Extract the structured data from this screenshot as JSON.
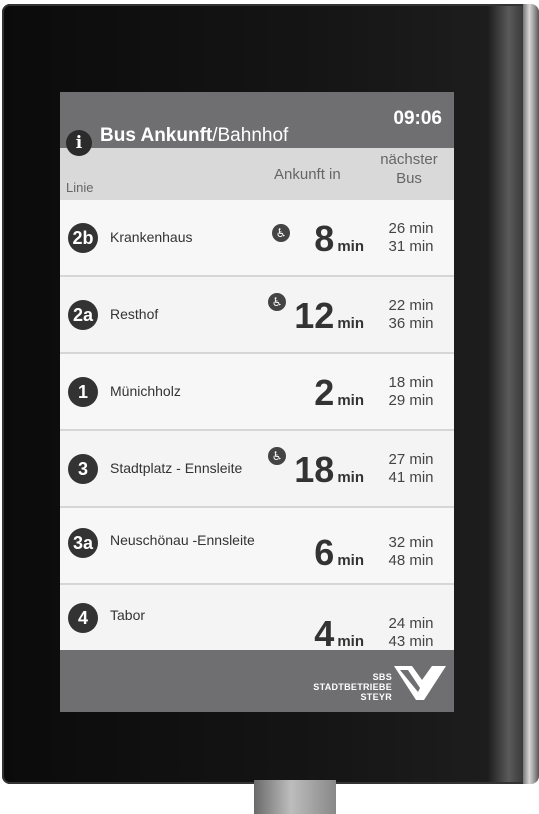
{
  "header": {
    "title_bold": "Bus Ankunft",
    "title_rest": "/Bahnhof",
    "time": "09:06"
  },
  "columns": {
    "line": "Linie",
    "arrival": "Ankunft in",
    "next": [
      "nächster",
      "Bus"
    ]
  },
  "rows": [
    {
      "line": "2b",
      "destination": "Krankenhaus",
      "accessible": true,
      "minutes": "8",
      "unit": "min",
      "next": [
        "26 min",
        "31 min"
      ]
    },
    {
      "line": "2a",
      "destination": "Resthof",
      "accessible": true,
      "minutes": "12",
      "unit": "min",
      "next": [
        "22 min",
        "36 min"
      ]
    },
    {
      "line": "1",
      "destination": "Münichholz",
      "accessible": false,
      "minutes": "2",
      "unit": "min",
      "next": [
        "18 min",
        "29 min"
      ]
    },
    {
      "line": "3",
      "destination": "Stadtplatz - Ennsleite",
      "accessible": true,
      "minutes": "18",
      "unit": "min",
      "next": [
        "27 min",
        "41 min"
      ]
    },
    {
      "line": "3a",
      "destination": "Neuschönau -Ennsleite",
      "accessible": false,
      "minutes": "6",
      "unit": "min",
      "next": [
        "32 min",
        "48 min"
      ]
    },
    {
      "line": "4",
      "destination": "Tabor",
      "accessible": false,
      "minutes": "4",
      "unit": "min",
      "next": [
        "24 min",
        "43 min"
      ]
    }
  ],
  "footer": {
    "logo_lines": [
      "SBS",
      "STADTBETRIEBE",
      "STEYR"
    ]
  },
  "icons": {
    "info": "info-icon",
    "wheelchair": "wheelchair-icon"
  },
  "colors": {
    "header": "#6f6f71",
    "badge": "#333333",
    "screen": "#f2f2f2"
  }
}
